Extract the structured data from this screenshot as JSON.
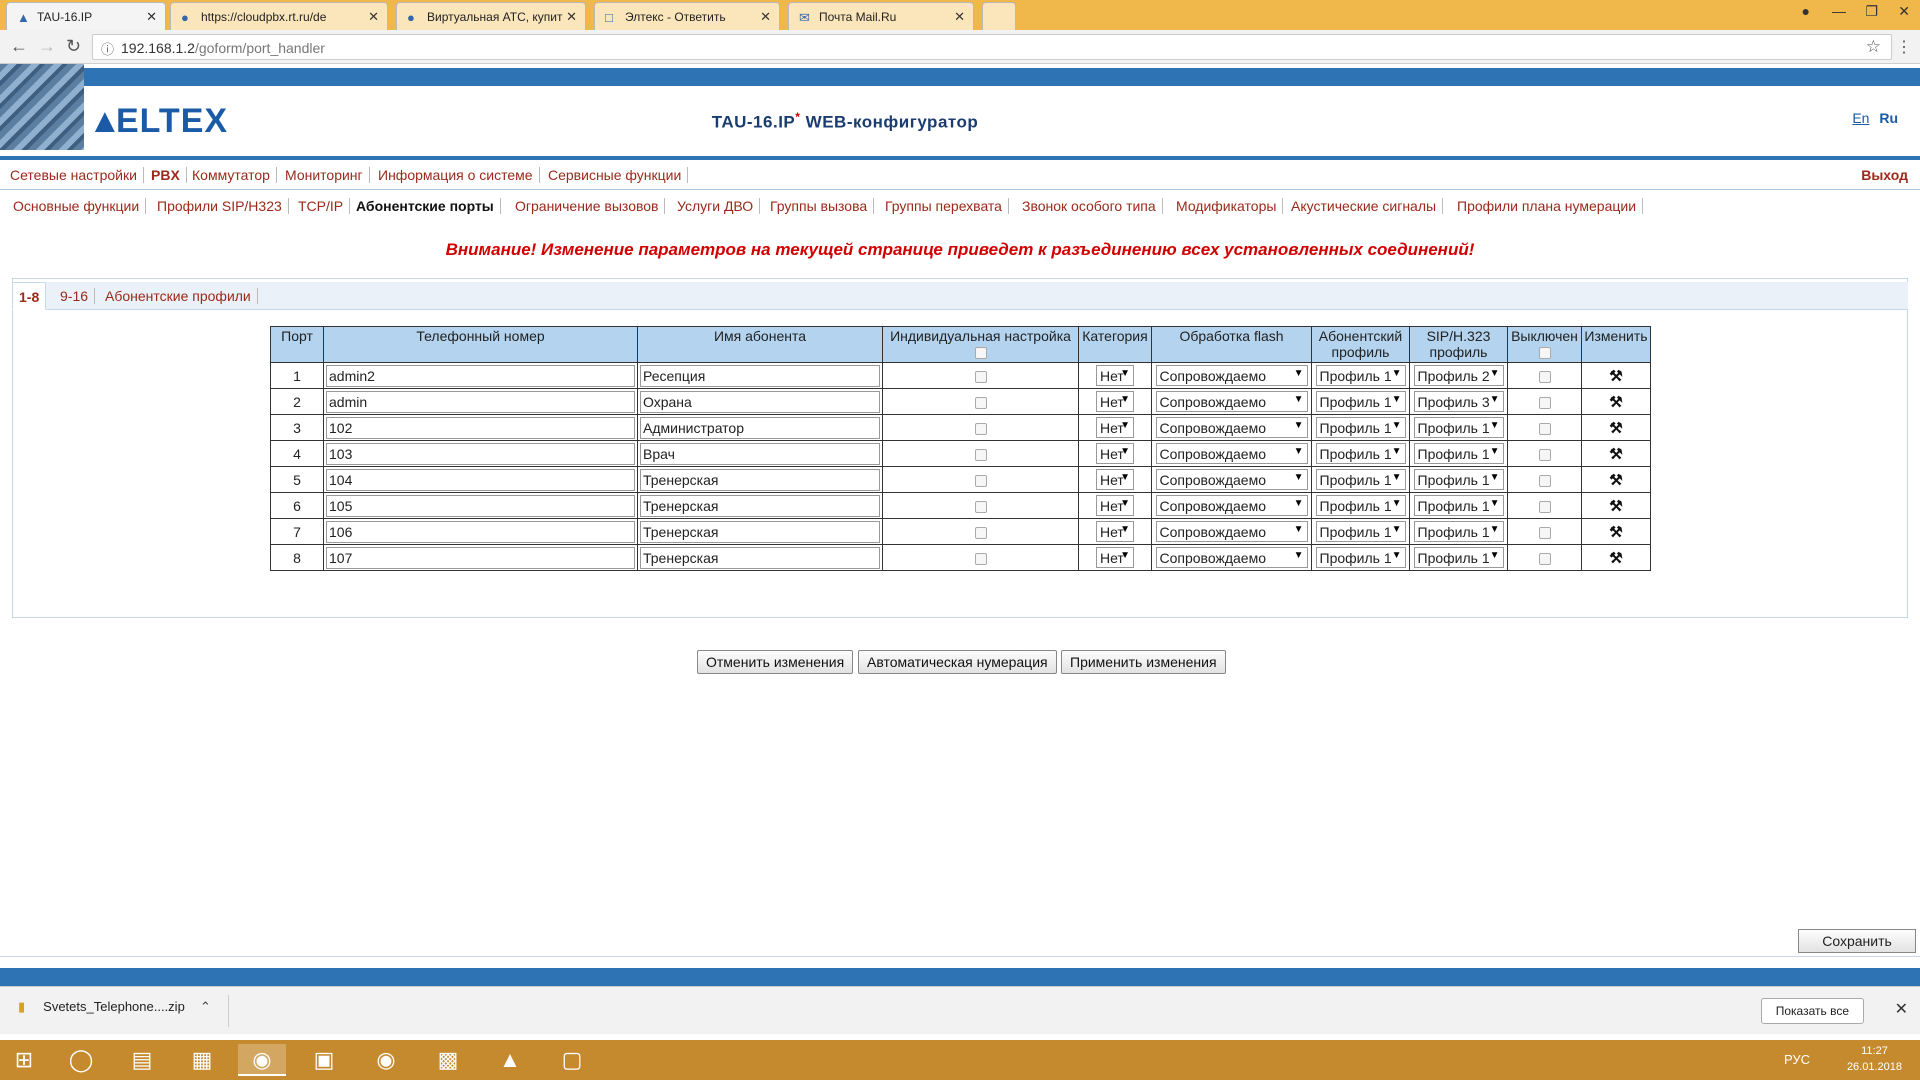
{
  "browser": {
    "tabs": [
      {
        "title": "TAU-16.IP",
        "active": true
      },
      {
        "title": "https://cloudpbx.rt.ru/de",
        "active": false
      },
      {
        "title": "Виртуальная АТС, купит",
        "active": false
      },
      {
        "title": "Элтекс - Ответить",
        "active": false
      },
      {
        "title": "Почта Mail.Ru",
        "active": false
      }
    ],
    "url_host": "192.168.1.2",
    "url_path": "/goform/port_handler"
  },
  "header": {
    "logo": "ELTEX",
    "title": "TAU-16.IP",
    "title_star": "*",
    "title_suffix": " WEB-конфигуратор",
    "lang_en": "En",
    "lang_ru": "Ru"
  },
  "main_menu": {
    "items": [
      "Сетевые настройки",
      "PBX",
      "Коммутатор",
      "Мониторинг",
      "Информация о системе",
      "Сервисные функции"
    ],
    "logout": "Выход"
  },
  "sub_menu": {
    "items": [
      "Основные функции",
      "Профили SIP/H323",
      "TCP/IP",
      "Абонентские порты",
      "Ограничение вызовов",
      "Услуги ДВО",
      "Группы вызова",
      "Группы перехвата",
      "Звонок особого типа",
      "Модификаторы",
      "Акустические сигналы",
      "Профили плана нумерации"
    ]
  },
  "warning": "Внимание! Изменение параметров на текущей странице приведет к разъединению всех установленных соединений!",
  "page_tabs": [
    "1-8",
    "9-16",
    "Абонентские профили"
  ],
  "table": {
    "headers": {
      "port": "Порт",
      "phone": "Телефонный номер",
      "name": "Имя абонента",
      "individual": "Индивидуальная настройка",
      "category": "Категория",
      "flash": "Обработка flash",
      "subscriber_profile_1": "Абонентский",
      "subscriber_profile_2": "профиль",
      "sip_profile_1": "SIP/H.323",
      "sip_profile_2": "профиль",
      "disabled": "Выключен",
      "edit": "Изменить"
    },
    "rows": [
      {
        "port": "1",
        "phone": "admin2",
        "name": "Ресепция",
        "category": "Нет",
        "flash": "Сопровождаемо",
        "sub_profile": "Профиль 1",
        "sip_profile": "Профиль 2"
      },
      {
        "port": "2",
        "phone": "admin",
        "name": "Охрана",
        "category": "Нет",
        "flash": "Сопровождаемо",
        "sub_profile": "Профиль 1",
        "sip_profile": "Профиль 3"
      },
      {
        "port": "3",
        "phone": "102",
        "name": "Администратор",
        "category": "Нет",
        "flash": "Сопровождаемо",
        "sub_profile": "Профиль 1",
        "sip_profile": "Профиль 1"
      },
      {
        "port": "4",
        "phone": "103",
        "name": "Врач",
        "category": "Нет",
        "flash": "Сопровождаемо",
        "sub_profile": "Профиль 1",
        "sip_profile": "Профиль 1"
      },
      {
        "port": "5",
        "phone": "104",
        "name": "Тренерская",
        "category": "Нет",
        "flash": "Сопровождаемо",
        "sub_profile": "Профиль 1",
        "sip_profile": "Профиль 1"
      },
      {
        "port": "6",
        "phone": "105",
        "name": "Тренерская",
        "category": "Нет",
        "flash": "Сопровождаемо",
        "sub_profile": "Профиль 1",
        "sip_profile": "Профиль 1"
      },
      {
        "port": "7",
        "phone": "106",
        "name": "Тренерская",
        "category": "Нет",
        "flash": "Сопровождаемо",
        "sub_profile": "Профиль 1",
        "sip_profile": "Профиль 1"
      },
      {
        "port": "8",
        "phone": "107",
        "name": "Тренерская",
        "category": "Нет",
        "flash": "Сопровождаемо",
        "sub_profile": "Профиль 1",
        "sip_profile": "Профиль 1"
      }
    ]
  },
  "buttons": {
    "cancel": "Отменить изменения",
    "auto_number": "Автоматическая нумерация",
    "apply": "Применить изменения",
    "save": "Сохранить"
  },
  "downloads": {
    "file": "Svetets_Telephone....zip",
    "show_all": "Показать все"
  },
  "taskbar": {
    "lang": "РУС",
    "time": "11:27",
    "date": "26.01.2018"
  },
  "colors": {
    "brand_blue": "#2e74b5",
    "menu_red": "#9a2a1a",
    "warning_red": "#d00000",
    "table_header": "#b3d3ee",
    "taskbar": "#c58a2e"
  }
}
